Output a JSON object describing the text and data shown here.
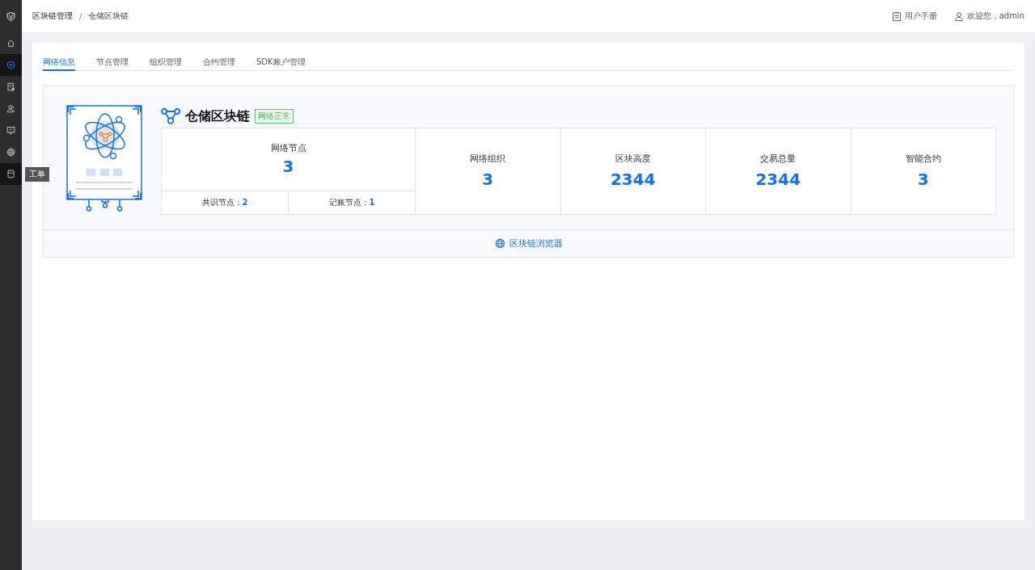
{
  "sidebar": {
    "items": [
      {
        "selected": false
      },
      {
        "selected": true
      },
      {
        "selected": false
      },
      {
        "selected": false
      },
      {
        "selected": false
      },
      {
        "selected": false
      },
      {
        "selected": false,
        "tooltip": "工单"
      }
    ]
  },
  "header": {
    "breadcrumb": [
      "区块链管理",
      "仓储区块链"
    ],
    "separator": "/",
    "manual": "用户手册",
    "user": "欢迎您，admin"
  },
  "tabs": [
    {
      "label": "网络信息",
      "selected": true
    },
    {
      "label": "节点管理",
      "selected": false
    },
    {
      "label": "组织管理",
      "selected": false
    },
    {
      "label": "合约管理",
      "selected": false
    },
    {
      "label": "SDK账户管理",
      "selected": false
    }
  ],
  "network": {
    "name": "仓储区块链",
    "status": "网络正常",
    "nodes": {
      "label": "网络节点",
      "value": "3",
      "breakdown": [
        {
          "label": "共识节点：",
          "value": "2"
        },
        {
          "label": "记账节点：",
          "value": "1"
        }
      ]
    },
    "stats": [
      {
        "label": "网络组织",
        "value": "3"
      },
      {
        "label": "区块高度",
        "value": "2344"
      },
      {
        "label": "交易总量",
        "value": "2344"
      },
      {
        "label": "智能合约",
        "value": "3"
      }
    ],
    "browser_link": "区块链浏览器"
  }
}
